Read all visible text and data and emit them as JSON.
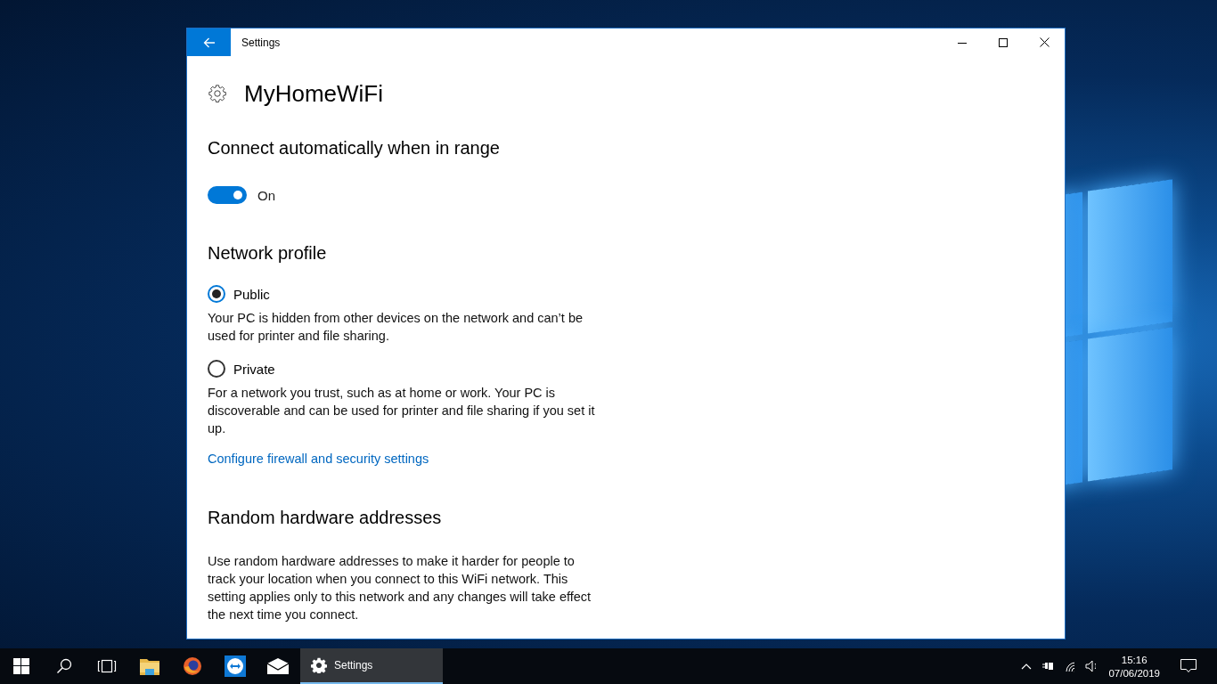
{
  "window": {
    "title": "Settings",
    "heading": "MyHomeWiFi"
  },
  "auto_connect": {
    "title": "Connect automatically when in range",
    "toggle": {
      "on": true,
      "label": "On"
    }
  },
  "network_profile": {
    "title": "Network profile",
    "options": [
      {
        "label": "Public",
        "selected": true,
        "description": "Your PC is hidden from other devices on the network and can’t be used for printer and file sharing."
      },
      {
        "label": "Private",
        "selected": false,
        "description": "For a network you trust, such as at home or work. Your PC is discoverable and can be used for printer and file sharing if you set it up."
      }
    ],
    "link": "Configure firewall and security settings"
  },
  "random_hw": {
    "title": "Random hardware addresses",
    "description": "Use random hardware addresses to make it harder for people to track your location when you connect to this WiFi network. This setting applies only to this network and any changes will take effect the next time you connect."
  },
  "taskbar": {
    "running_app": {
      "label": "Settings",
      "selected": true
    },
    "time": "15:16",
    "date": "07/06/2019"
  }
}
